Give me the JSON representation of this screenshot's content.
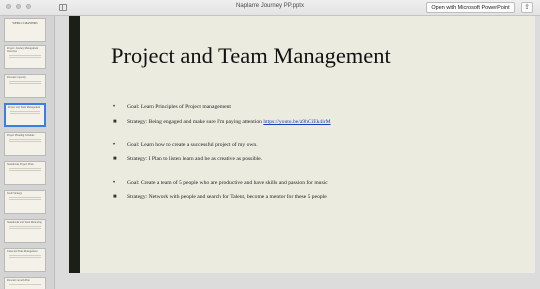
{
  "window": {
    "title": "Naplarre Journey PP.pptx",
    "open_button": "Open with Microsoft PowerPoint"
  },
  "sidebar": {
    "thumbnails": [
      {
        "label": "WEEK 15 MASTERS",
        "selected": false
      },
      {
        "label": "Project: Journey Management Overview",
        "selected": false
      },
      {
        "label": "Personal Capacity",
        "selected": false
      },
      {
        "label": "Project and Team Management",
        "selected": true
      },
      {
        "label": "Project Planning Schedule",
        "selected": false
      },
      {
        "label": "Stakeholder Project Plans",
        "selected": false
      },
      {
        "label": "Team Strategy",
        "selected": false
      },
      {
        "label": "Stakeholder and Team Mentoring",
        "selected": false
      },
      {
        "label": "Tasks and Time Management",
        "selected": false
      },
      {
        "label": "Personal Growth Plan",
        "selected": false
      }
    ]
  },
  "slide": {
    "title": "Project and Team Management",
    "bullets": [
      {
        "marker": "•",
        "text": "Goal: Learn Principles of Project management",
        "link": ""
      },
      {
        "marker": "■",
        "text": "Strategy: Being engaged and make sure I'm paying attention ",
        "link": "https://youtu.be/a9hCiEk4irM"
      },
      {
        "marker": "•",
        "text": "Goal: Learn how to create a successful project of my own.",
        "link": ""
      },
      {
        "marker": "■",
        "text": "Strategy: I Plan to listen learn and be as creative as possible.",
        "link": ""
      },
      {
        "marker": "•",
        "text": "Goal: Create a team of 5 people who are productive and have skills and passion for music",
        "link": ""
      },
      {
        "marker": "■",
        "text": "Strategy: Network with people and search for Talent, become a mentor for these 5 people",
        "link": ""
      }
    ]
  },
  "colors": {
    "slide_background": "#ecebe0",
    "slide_bar": "#1b1f17",
    "selected_thumb_border": "#3a7ee6",
    "link": "#1a3fb0"
  }
}
